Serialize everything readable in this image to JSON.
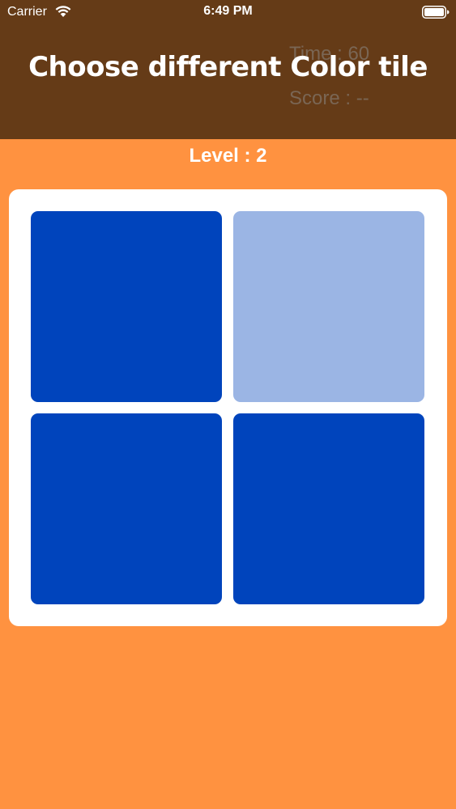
{
  "status_bar": {
    "carrier": "Carrier",
    "time": "6:49 PM",
    "icons": [
      "wifi-icon",
      "battery-icon"
    ]
  },
  "header": {
    "title": "Choose different Color tile",
    "time_text": "Time : 60",
    "score_text": "Score : --",
    "background_color": "#653B17"
  },
  "level_text": "Level : 2",
  "game_background_color": "#FF9240",
  "board": {
    "background_color": "#FFFFFF",
    "columns": 2,
    "rows": 2,
    "tiles": [
      {
        "color": "#0044BC",
        "is_different": false
      },
      {
        "color": "#9BB5E4",
        "is_different": true
      },
      {
        "color": "#0044BC",
        "is_different": false
      },
      {
        "color": "#0044BC",
        "is_different": false
      }
    ]
  }
}
